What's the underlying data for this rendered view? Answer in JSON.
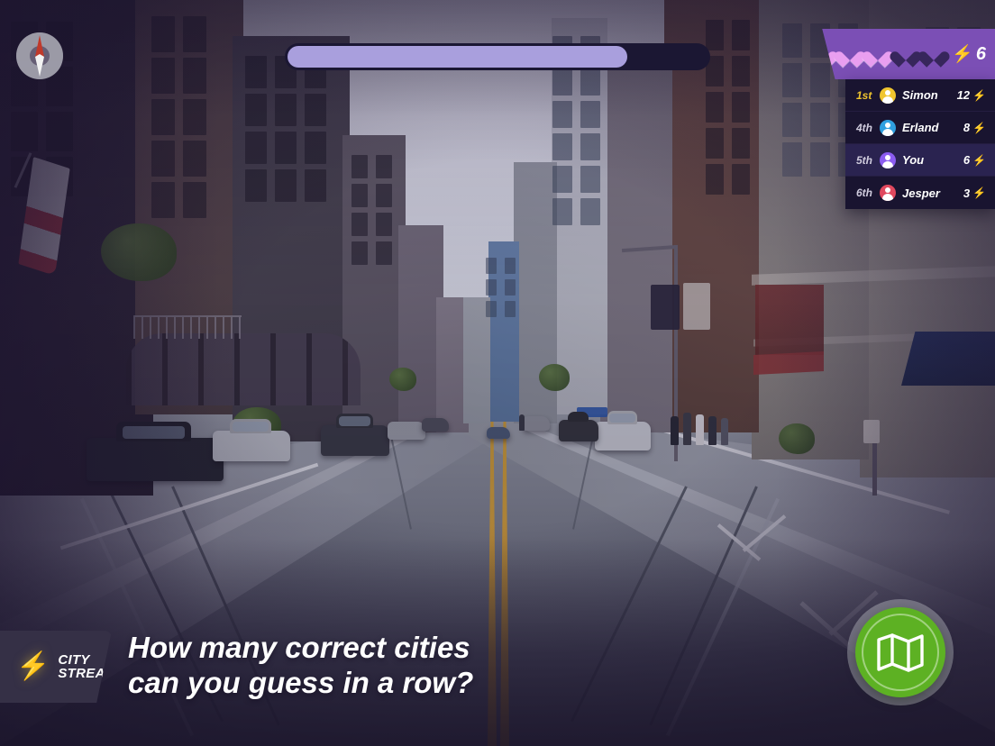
{
  "app": {
    "brand_line1": "CITY",
    "brand_line2": "STREAKS",
    "brand_icon": "lightning-bolt-icon",
    "tagline_line1": "How many correct cities",
    "tagline_line2": "can you guess in a row?"
  },
  "hud": {
    "compass_icon": "compass-needle-icon",
    "progress": {
      "percent": 81
    },
    "lives": {
      "total": 5,
      "remaining": 3,
      "states": [
        "full",
        "full",
        "full",
        "empty",
        "empty"
      ]
    },
    "streak": {
      "value": "6",
      "icon": "lightning-bolt-icon"
    }
  },
  "leaderboard": {
    "rows": [
      {
        "rank": "1st",
        "name": "Simon",
        "score": "12",
        "avatar_icon": "avatar-icon",
        "avatar_color": "#f0c52e",
        "is_me": false,
        "is_first": true
      },
      {
        "rank": "4th",
        "name": "Erland",
        "score": "8",
        "avatar_icon": "avatar-icon",
        "avatar_color": "#2f9fe0",
        "is_me": false,
        "is_first": false
      },
      {
        "rank": "5th",
        "name": "You",
        "score": "6",
        "avatar_icon": "avatar-icon",
        "avatar_color": "#8b5cf0",
        "is_me": true,
        "is_first": false
      },
      {
        "rank": "6th",
        "name": "Jesper",
        "score": "3",
        "avatar_icon": "avatar-icon",
        "avatar_color": "#e0485e",
        "is_me": false,
        "is_first": false
      }
    ],
    "score_icon": "lightning-bolt-icon"
  },
  "map_button": {
    "icon": "map-icon",
    "color": "#5db123"
  },
  "colors": {
    "panel_purple": "#7b4fb5",
    "leaderboard_bg": "#191430",
    "leaderboard_highlight": "#2a2350",
    "progress_fill": "#a99fdd",
    "progress_track": "#1b1733",
    "accent_yellow": "#f5d02e",
    "heart_full": "#e99ef0",
    "heart_empty": "#37265c"
  },
  "scene": {
    "description": "city-street-photo"
  }
}
